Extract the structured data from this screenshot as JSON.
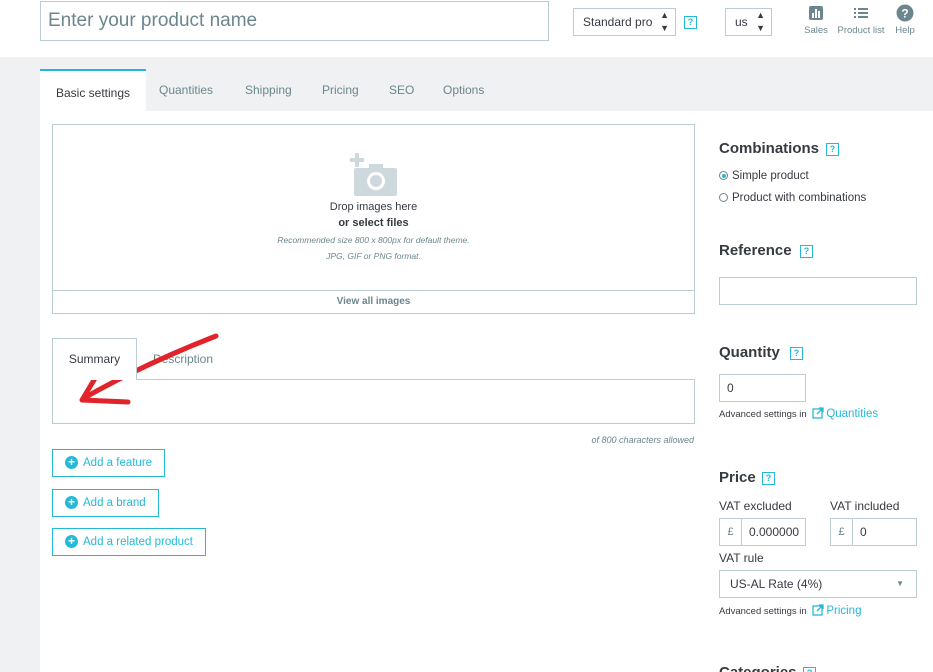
{
  "header": {
    "product_name_placeholder": "Enter your product name",
    "product_type": "Standard pro",
    "help": "?",
    "language": "us",
    "tools": {
      "sales": "Sales",
      "product_list": "Product list",
      "help": "Help"
    }
  },
  "tabs": [
    "Basic settings",
    "Quantities",
    "Shipping",
    "Pricing",
    "SEO",
    "Options"
  ],
  "images": {
    "drop": "Drop images here",
    "select": "or select files",
    "rec1": "Recommended size 800 x 800px for default theme.",
    "rec2": "JPG, GIF or PNG format.",
    "view_all": "View all images"
  },
  "desc_tabs": [
    "Summary",
    "Description"
  ],
  "char_count": "of 800 characters allowed",
  "buttons": {
    "feature": "Add a feature",
    "brand": "Add a brand",
    "related": "Add a related product"
  },
  "combinations": {
    "title": "Combinations",
    "simple": "Simple product",
    "with": "Product with combinations"
  },
  "reference": {
    "title": "Reference",
    "value": ""
  },
  "quantity": {
    "title": "Quantity",
    "value": "0",
    "adv": "Advanced settings in",
    "link": "Quantities"
  },
  "price": {
    "title": "Price",
    "excl_label": "VAT excluded",
    "incl_label": "VAT included",
    "currency": "£",
    "excl_value": "0.000000",
    "incl_value": "0",
    "rule_label": "VAT rule",
    "rule_value": "US-AL Rate (4%)",
    "adv": "Advanced settings in",
    "link": "Pricing"
  },
  "categories": {
    "title": "Categories"
  },
  "colors": {
    "accent": "#25b9d7",
    "annotation": "#e2232a"
  }
}
